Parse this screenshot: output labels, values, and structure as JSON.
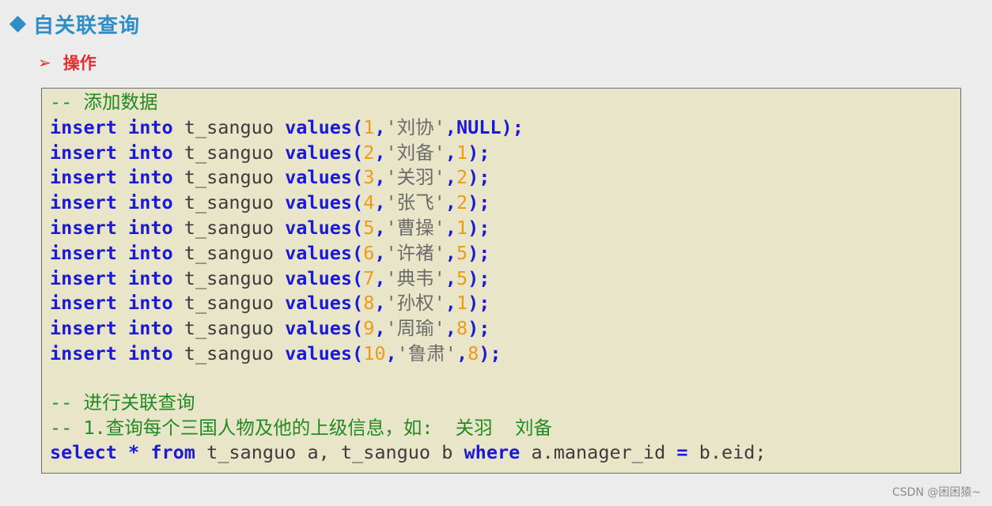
{
  "heading": "自关联查询",
  "subheading": "操作",
  "code": {
    "comment_add": "-- 添加数据",
    "kw_insert": "insert",
    "kw_into": "into",
    "table": "t_sanguo",
    "kw_values": "values",
    "null_kw": "NULL",
    "inserts": [
      {
        "id": "1",
        "name": "'刘协'",
        "mid": "NULL"
      },
      {
        "id": "2",
        "name": "'刘备'",
        "mid": "1"
      },
      {
        "id": "3",
        "name": "'关羽'",
        "mid": "2"
      },
      {
        "id": "4",
        "name": "'张飞'",
        "mid": "2"
      },
      {
        "id": "5",
        "name": "'曹操'",
        "mid": "1"
      },
      {
        "id": "6",
        "name": "'许褚'",
        "mid": "5"
      },
      {
        "id": "7",
        "name": "'典韦'",
        "mid": "5"
      },
      {
        "id": "8",
        "name": "'孙权'",
        "mid": "1"
      },
      {
        "id": "9",
        "name": "'周瑜'",
        "mid": "8"
      },
      {
        "id": "10",
        "name": "'鲁肃'",
        "mid": "8"
      }
    ],
    "comment_query": "-- 进行关联查询",
    "comment_q1": "-- 1.查询每个三国人物及他的上级信息，如:  关羽  刘备",
    "select_kw": "select",
    "star": "*",
    "from_kw": "from",
    "from_tables": "t_sanguo a, t_sanguo b",
    "where_kw": "where",
    "where_cond": "a.manager_id",
    "eq": "=",
    "where_rhs": "b.eid;"
  },
  "watermark": "CSDN @困困猿~"
}
